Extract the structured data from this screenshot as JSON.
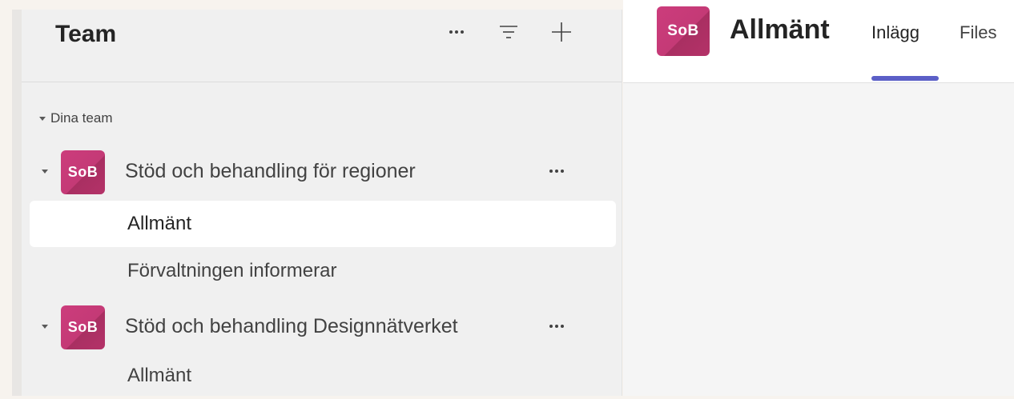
{
  "sidebar": {
    "title": "Team",
    "section_label": "Dina team",
    "teams": [
      {
        "avatar": "SoB",
        "name": "Stöd och behandling för regioner",
        "channels": [
          {
            "label": "Allmänt",
            "selected": true
          },
          {
            "label": "Förvaltningen informerar",
            "selected": false
          }
        ]
      },
      {
        "avatar": "SoB",
        "name": "Stöd och behandling Designnätverket",
        "channels": [
          {
            "label": "Allmänt",
            "selected": false
          }
        ]
      }
    ],
    "icons": [
      "more-options-icon",
      "filter-icon",
      "add-icon"
    ]
  },
  "main": {
    "avatar": "SoB",
    "title": "Allmänt",
    "tabs": [
      {
        "label": "Inlägg",
        "active": true
      },
      {
        "label": "Files",
        "active": false
      }
    ]
  },
  "colors": {
    "accent": "#5b5fc7",
    "avatar": "#c43a76",
    "sidebar_bg": "#f0f0f0",
    "page_bg": "#f7f3ee"
  }
}
